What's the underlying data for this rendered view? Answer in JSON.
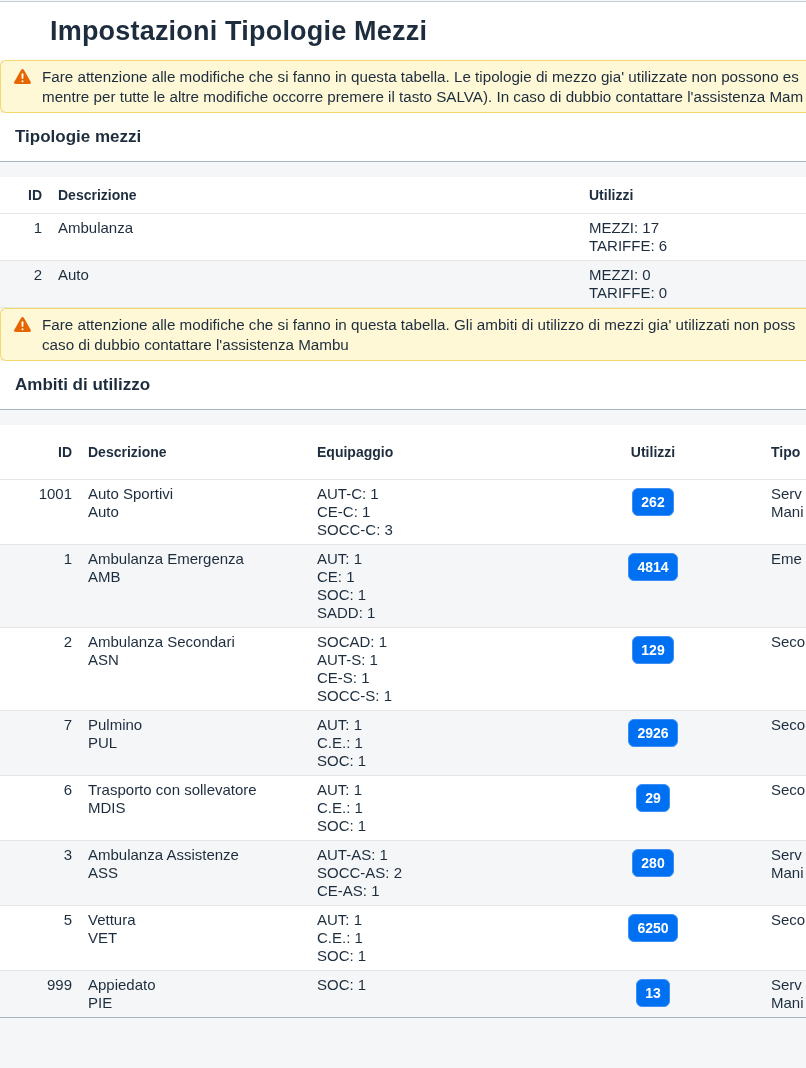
{
  "page": {
    "title": "Impostazioni Tipologie Mezzi"
  },
  "sections": [
    {
      "warning": {
        "lines": [
          "Fare attenzione alle modifiche che si fanno in questa tabella. Le tipologie di mezzo gia' utilizzate non possono es",
          "mentre per tutte le altre modifiche occorre premere il tasto SALVA). In caso di dubbio contattare l'assistenza Mam"
        ]
      },
      "title": "Tipologie mezzi",
      "table": {
        "columns": [
          {
            "label": "ID",
            "kind": "id"
          },
          {
            "label": "Descrizione",
            "kind": "text"
          },
          {
            "label": "Utilizzi",
            "kind": "text"
          }
        ],
        "rows": [
          {
            "cells": [
              "1",
              [
                "Ambulanza"
              ],
              [
                "MEZZI: 17",
                "TARIFFE: 6"
              ]
            ]
          },
          {
            "cells": [
              "2",
              [
                "Auto"
              ],
              [
                "MEZZI: 0",
                "TARIFFE: 0"
              ]
            ]
          }
        ]
      }
    },
    {
      "warning": {
        "lines": [
          "Fare attenzione alle modifiche che si fanno in questa tabella. Gli ambiti di utilizzo di mezzi gia' utilizzati non poss",
          "caso di dubbio contattare l'assistenza Mambu"
        ]
      },
      "title": "Ambiti di utilizzo",
      "table": {
        "columns": [
          {
            "label": "ID",
            "kind": "id"
          },
          {
            "label": "Descrizione",
            "kind": "text"
          },
          {
            "label": "Equipaggio",
            "kind": "text"
          },
          {
            "label": "Utilizzi",
            "kind": "badge"
          },
          {
            "label": "Tipo",
            "kind": "text"
          }
        ],
        "rows": [
          {
            "cells": [
              "1001",
              [
                "Auto Sportivi",
                "Auto"
              ],
              [
                "AUT-C: 1",
                "CE-C: 1",
                "SOCC-C: 3"
              ],
              "262",
              [
                "Serv",
                "Mani"
              ]
            ]
          },
          {
            "cells": [
              "1",
              [
                "Ambulanza Emergenza",
                "AMB"
              ],
              [
                "AUT: 1",
                "CE: 1",
                "SOC: 1",
                "SADD: 1"
              ],
              "4814",
              [
                "Eme"
              ]
            ]
          },
          {
            "cells": [
              "2",
              [
                "Ambulanza Secondari",
                "ASN"
              ],
              [
                "SOCAD: 1",
                "AUT-S: 1",
                "CE-S: 1",
                "SOCC-S: 1"
              ],
              "129",
              [
                "Seco"
              ]
            ]
          },
          {
            "cells": [
              "7",
              [
                "Pulmino",
                "PUL"
              ],
              [
                "AUT: 1",
                "C.E.: 1",
                "SOC: 1"
              ],
              "2926",
              [
                "Seco"
              ]
            ]
          },
          {
            "cells": [
              "6",
              [
                "Trasporto con sollevatore",
                "MDIS"
              ],
              [
                "AUT: 1",
                "C.E.: 1",
                "SOC: 1"
              ],
              "29",
              [
                "Seco"
              ]
            ]
          },
          {
            "cells": [
              "3",
              [
                "Ambulanza Assistenze",
                "ASS"
              ],
              [
                "AUT-AS: 1",
                "SOCC-AS: 2",
                "CE-AS: 1"
              ],
              "280",
              [
                "Serv",
                "Mani"
              ]
            ]
          },
          {
            "cells": [
              "5",
              [
                "Vettura",
                "VET"
              ],
              [
                "AUT: 1",
                "C.E.: 1",
                "SOC: 1"
              ],
              "6250",
              [
                "Seco"
              ]
            ]
          },
          {
            "cells": [
              "999",
              [
                "Appiedato",
                "PIE"
              ],
              [
                "SOC: 1"
              ],
              "13",
              [
                "Serv",
                "Mani"
              ]
            ]
          }
        ]
      }
    }
  ]
}
